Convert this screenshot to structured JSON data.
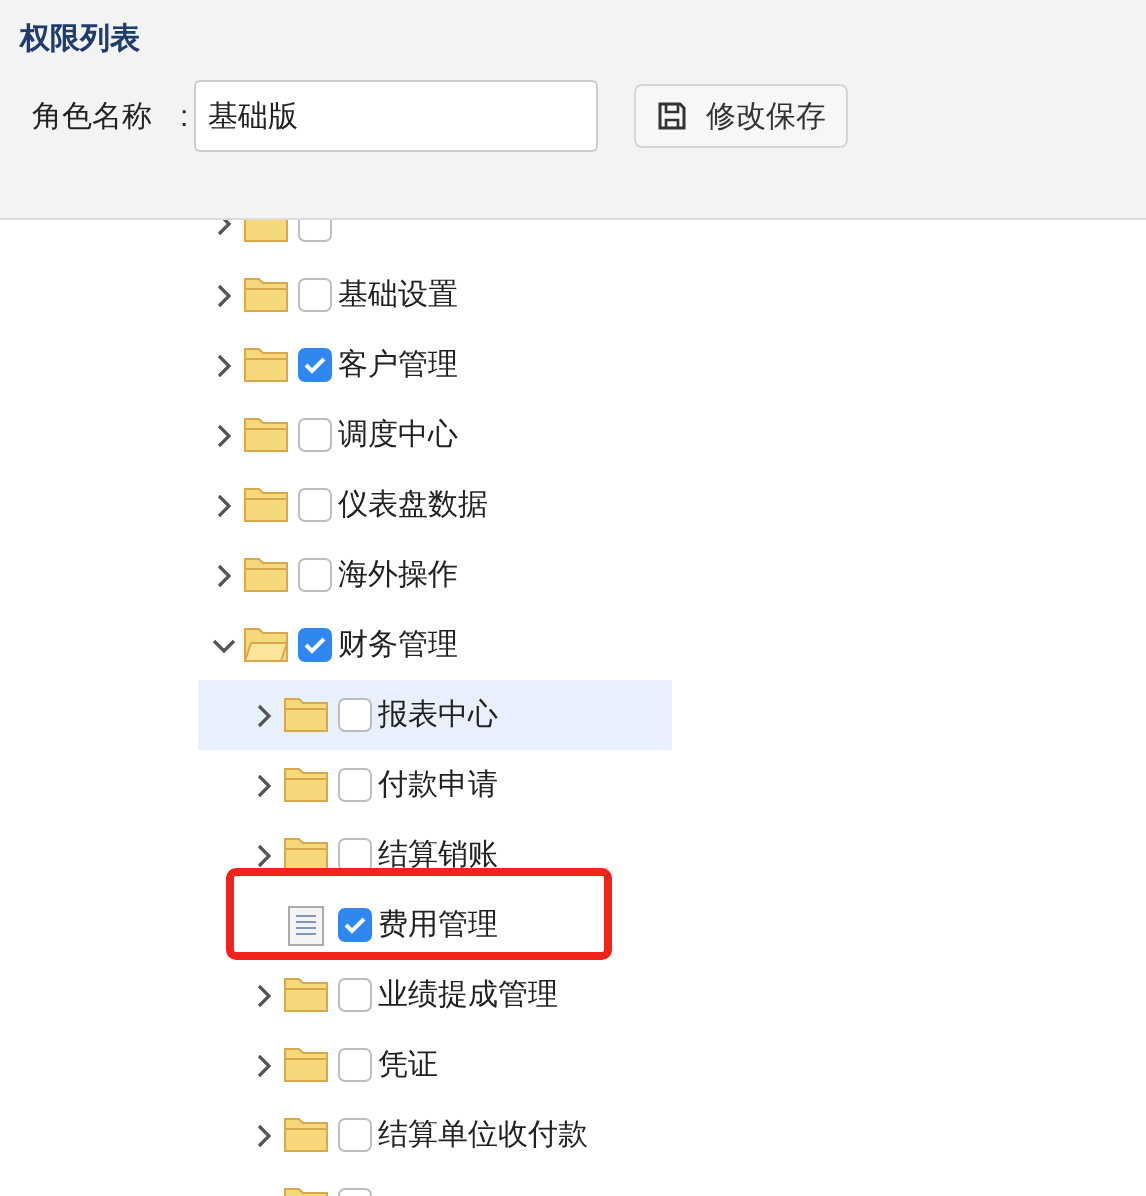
{
  "panel_title": "权限列表",
  "role": {
    "label": "角色名称",
    "colon": ":",
    "value": "基础版"
  },
  "save_button": {
    "label": "修改保存"
  },
  "tree": [
    {
      "kind": "folder",
      "checked": false,
      "expanded": false,
      "selected": false
    },
    {
      "kind": "folder",
      "label": "基础设置",
      "checked": false,
      "expanded": false,
      "selected": false
    },
    {
      "kind": "folder",
      "label": "客户管理",
      "checked": true,
      "expanded": false,
      "selected": false
    },
    {
      "kind": "folder",
      "label": "调度中心",
      "checked": false,
      "expanded": false,
      "selected": false
    },
    {
      "kind": "folder",
      "label": "仪表盘数据",
      "checked": false,
      "expanded": false,
      "selected": false
    },
    {
      "kind": "folder",
      "label": "海外操作",
      "checked": false,
      "expanded": false,
      "selected": false
    },
    {
      "kind": "folder",
      "label": "财务管理",
      "checked": true,
      "expanded": true,
      "selected": false,
      "children": [
        {
          "kind": "folder",
          "label": "报表中心",
          "checked": false,
          "expanded": false,
          "selected": true
        },
        {
          "kind": "folder",
          "label": "付款申请",
          "checked": false,
          "expanded": false,
          "selected": false
        },
        {
          "kind": "folder",
          "label": "结算销账",
          "checked": false,
          "expanded": false,
          "selected": false
        },
        {
          "kind": "file",
          "label": "费用管理",
          "checked": true,
          "selected": false,
          "annotated": true
        },
        {
          "kind": "folder",
          "label": "业绩提成管理",
          "checked": false,
          "expanded": false,
          "selected": false
        },
        {
          "kind": "folder",
          "label": "凭证",
          "checked": false,
          "expanded": false,
          "selected": false
        },
        {
          "kind": "folder",
          "label": "结算单位收付款",
          "checked": false,
          "expanded": false,
          "selected": false
        },
        {
          "kind": "folder",
          "checked": false,
          "selected": false
        }
      ]
    }
  ]
}
